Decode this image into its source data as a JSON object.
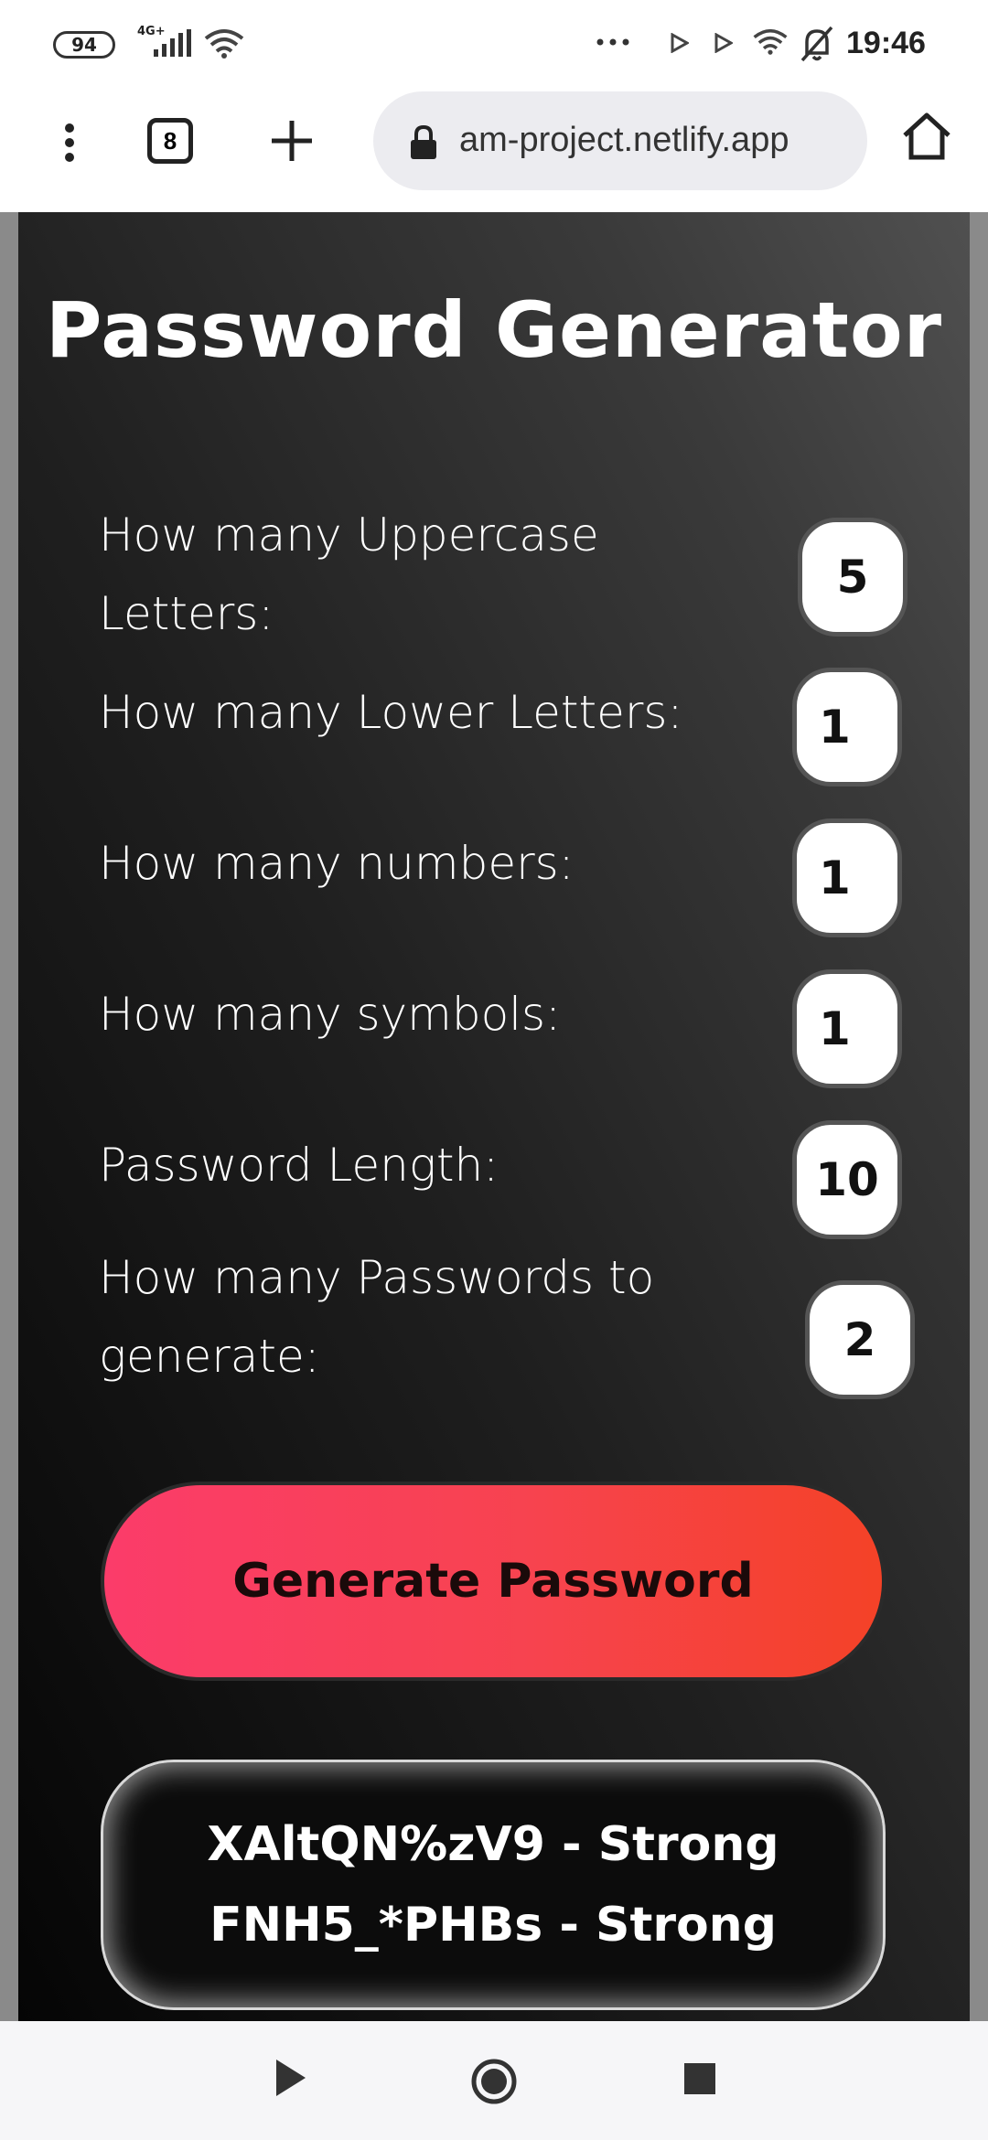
{
  "status_bar": {
    "battery": "94",
    "network_type": "4G+",
    "time": "19:46",
    "icons": [
      "signal-icon",
      "wifi-icon",
      "more-dots-icon",
      "play-icon",
      "play-icon",
      "wifi-icon",
      "bell-off-icon"
    ]
  },
  "browser": {
    "tab_count": "8",
    "url": "am-project.netlify.app",
    "icons": [
      "menu-icon",
      "new-tab-icon",
      "lock-icon",
      "home-icon"
    ]
  },
  "app": {
    "title": "Password Generator",
    "fields": [
      {
        "label_line1": "How many Uppercase",
        "label_line2": "Letters:",
        "value": "5"
      },
      {
        "label_line1": "How many Lower Letters:",
        "label_line2": "",
        "value": "1"
      },
      {
        "label_line1": "How many numbers:",
        "label_line2": "",
        "value": "1"
      },
      {
        "label_line1": "How many symbols:",
        "label_line2": "",
        "value": "1"
      },
      {
        "label_line1": "Password Length:",
        "label_line2": "",
        "value": "10"
      },
      {
        "label_line1": "How many Passwords to",
        "label_line2": "generate:",
        "value": "2"
      }
    ],
    "generate_label": "Generate Password",
    "results": [
      "XAltQN%zV9 - Strong",
      "FNH5_*PHBs - Strong"
    ],
    "colors": {
      "button_gradient_start": "#fb3c6a",
      "button_gradient_end": "#f44227",
      "card_dark": "#050505",
      "card_light": "#505050"
    }
  },
  "nav_bar": {
    "icons": [
      "back-triangle-icon",
      "home-circle-icon",
      "recents-square-icon"
    ]
  }
}
